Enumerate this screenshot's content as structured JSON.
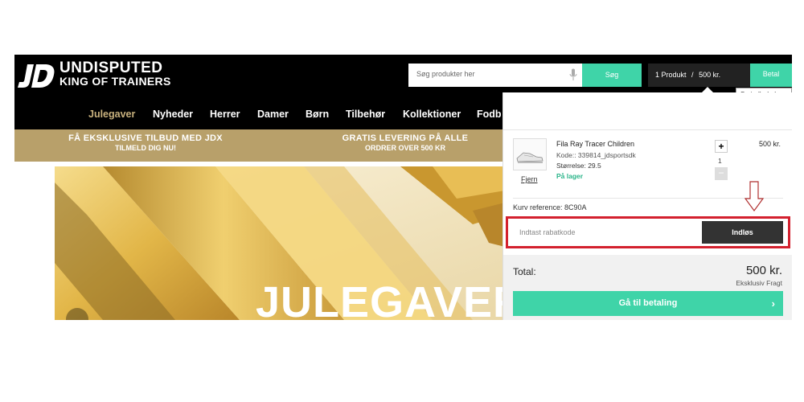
{
  "brand": {
    "line1": "UNDISPUTED",
    "line2": "KING OF TRAINERS"
  },
  "search": {
    "placeholder": "Søg produkter her",
    "button": "Søg"
  },
  "basket": {
    "count": "1 Produkt",
    "separator": "/",
    "amount": "500 kr.",
    "pay_button": "Betal",
    "tooltip": "Se indkøbskurv"
  },
  "nav": [
    "Julegaver",
    "Nyheder",
    "Herrer",
    "Damer",
    "Børn",
    "Tilbehør",
    "Kollektioner",
    "Fodb"
  ],
  "promos": [
    {
      "title": "FÅ EKSKLUSIVE TILBUD MED JDX",
      "sub": "TILMELD DIG NU!"
    },
    {
      "title": "GRATIS LEVERING PÅ ALLE",
      "sub": "ORDRER OVER 500 KR"
    }
  ],
  "hero": {
    "title": "JULEGAVER"
  },
  "cart_item": {
    "remove": "Fjern",
    "name": "Fila Ray Tracer Children",
    "code": "Kode:: 339814_jdsportsdk",
    "size": "Størrelse: 29.5",
    "stock": "På lager",
    "qty_plus": "+",
    "quantity": "1",
    "qty_minus": "−",
    "price": "500 kr."
  },
  "basket_ref": "Kurv reference:  8C90A",
  "coupon": {
    "placeholder": "Indtast rabatkode",
    "button": "Indløs"
  },
  "totals": {
    "label": "Total:",
    "value": "500 kr.",
    "note": "Eksklusiv Fragt"
  },
  "checkout": {
    "label": "Gå til betaling",
    "chevron": "›"
  },
  "colors": {
    "accent": "#3fd4a8",
    "gold": "#b8a06a",
    "header": "#000000",
    "highlight": "#d3202e"
  },
  "icons": [
    "jd-logo-icon",
    "microphone-icon",
    "chevron-right-icon",
    "arrow-down-icon",
    "shoe-thumbnail-icon",
    "chevron-left-icon"
  ]
}
